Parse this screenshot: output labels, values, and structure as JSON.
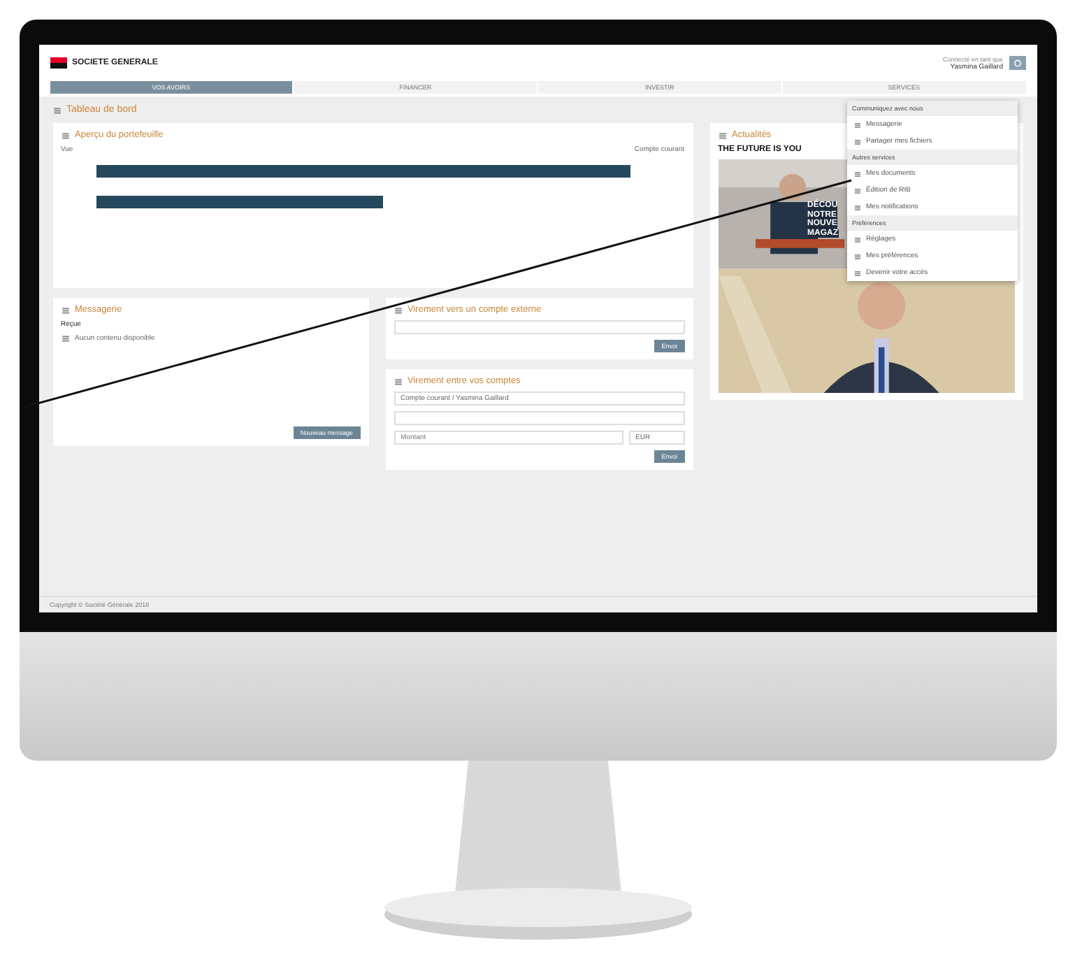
{
  "brand": "SOCIETE GENERALE",
  "user": {
    "label": "Connecté en tant que",
    "name": "Yasmina Gaillard"
  },
  "tabs": [
    {
      "label": "VOS AVOIRS",
      "selected": true
    },
    {
      "label": "FINANCER",
      "selected": false
    },
    {
      "label": "INVESTIR",
      "selected": false
    },
    {
      "label": "SERVICES",
      "selected": false
    }
  ],
  "page_title": "Tableau de bord",
  "portfolio": {
    "title": "Aperçu du portefeuille",
    "subtitle": "Vue",
    "right_label": "Compte courant"
  },
  "messages": {
    "title": "Messagerie",
    "tab": "Reçue",
    "empty": "Aucun contenu disponible",
    "button": "Nouveau message"
  },
  "external_transfer": {
    "title": "Virement vers un compte externe",
    "button": "Envoi"
  },
  "internal_transfer": {
    "title": "Virement entre vos comptes",
    "account": "Compte courant / Yasmina Gaillard",
    "amount_placeholder": "Montant",
    "currency": "EUR",
    "button": "Envoi"
  },
  "news": {
    "title": "Actualités",
    "banner": "THE FUTURE IS YOU",
    "headline": [
      "DÉCOU",
      "NOTRE",
      "NOUVE",
      "MAGAZ"
    ]
  },
  "menu": [
    {
      "heading": "Communiquez avec nous",
      "items": [
        "Messagerie",
        "Partager mes fichiers"
      ]
    },
    {
      "heading": "Autres services",
      "items": [
        "Mes documents",
        "Édition de RIB",
        "Mes notifications"
      ]
    },
    {
      "heading": "Préférences",
      "items": [
        "Réglages",
        "Mes préférences",
        "Devenir votre accès"
      ]
    }
  ],
  "footer": {
    "copyright": "Copyright © Société Générale 2018"
  }
}
